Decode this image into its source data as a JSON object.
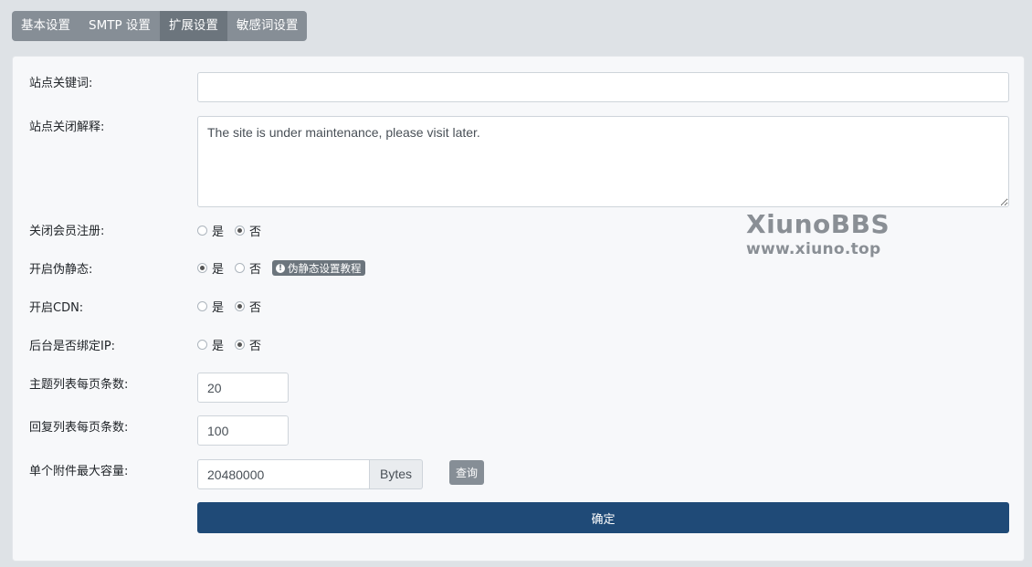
{
  "tabs": [
    {
      "label": "基本设置"
    },
    {
      "label": "SMTP 设置"
    },
    {
      "label": "扩展设置"
    },
    {
      "label": "敏感词设置"
    }
  ],
  "form": {
    "keywords": {
      "label": "站点关键词:",
      "value": ""
    },
    "close_reason": {
      "label": "站点关闭解释:",
      "value": "The site is under maintenance, please visit later."
    },
    "close_register": {
      "label": "关闭会员注册:",
      "yes": "是",
      "no": "否",
      "selected": "no"
    },
    "rewrite": {
      "label": "开启伪静态:",
      "yes": "是",
      "no": "否",
      "selected": "yes",
      "badge": "伪静态设置教程"
    },
    "cdn": {
      "label": "开启CDN:",
      "yes": "是",
      "no": "否",
      "selected": "no"
    },
    "bind_ip": {
      "label": "后台是否绑定IP:",
      "yes": "是",
      "no": "否",
      "selected": "no"
    },
    "threads_per_page": {
      "label": "主题列表每页条数:",
      "value": "20"
    },
    "posts_per_page": {
      "label": "回复列表每页条数:",
      "value": "100"
    },
    "max_attach": {
      "label": "单个附件最大容量:",
      "value": "20480000",
      "unit": "Bytes",
      "query_label": "查询"
    },
    "submit_label": "确定"
  },
  "watermark": {
    "line1": "XiunoBBS",
    "line2": "www.xiuno.top"
  },
  "colors": {
    "primary": "#1f4a77",
    "secondary": "#868e96",
    "active_tab": "#6c757d"
  }
}
